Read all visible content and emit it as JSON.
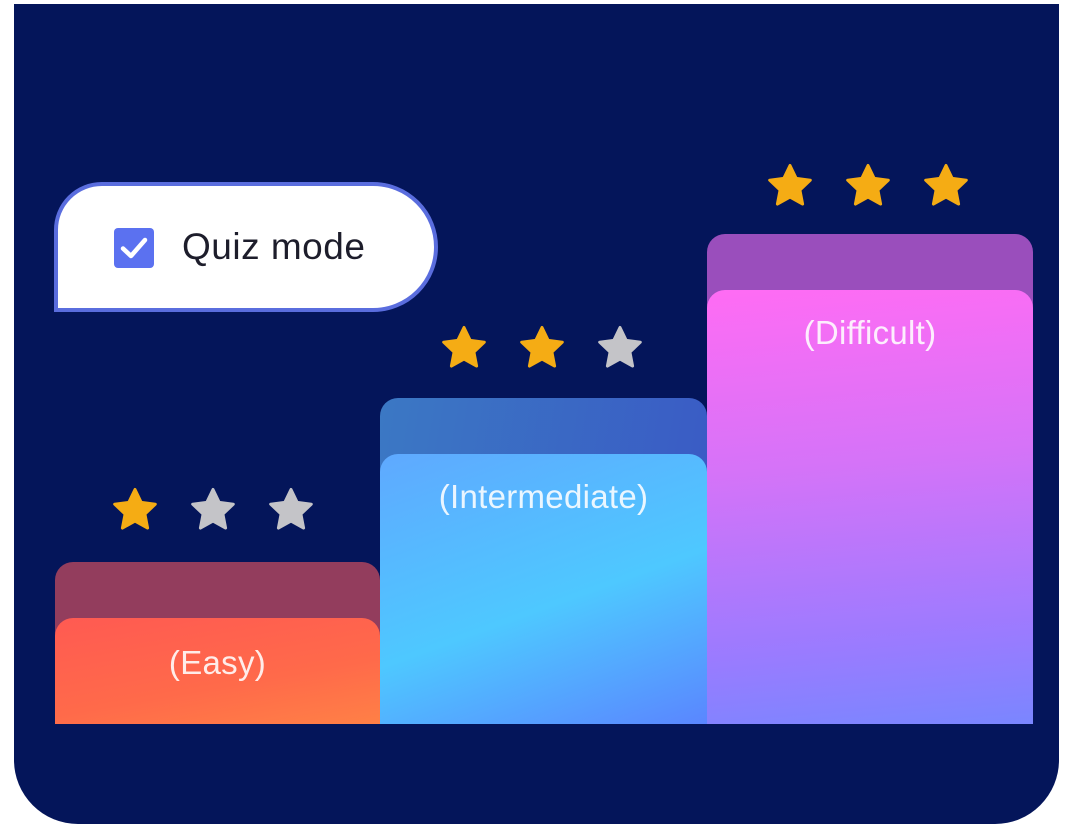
{
  "quiz_toggle": {
    "label": "Quiz mode",
    "checked": true,
    "check_color": "#5b71f0"
  },
  "levels": [
    {
      "label": "(Easy)",
      "stars_filled": 1,
      "stars_total": 3
    },
    {
      "label": "(Intermediate)",
      "stars_filled": 2,
      "stars_total": 3
    },
    {
      "label": "(Difficult)",
      "stars_filled": 3,
      "stars_total": 3
    }
  ],
  "colors": {
    "background": "#04155a",
    "star_filled": "#f5ac14",
    "star_empty": "#c4c4c8"
  },
  "icons": {
    "check": "checkmark-icon",
    "star": "star-icon"
  }
}
